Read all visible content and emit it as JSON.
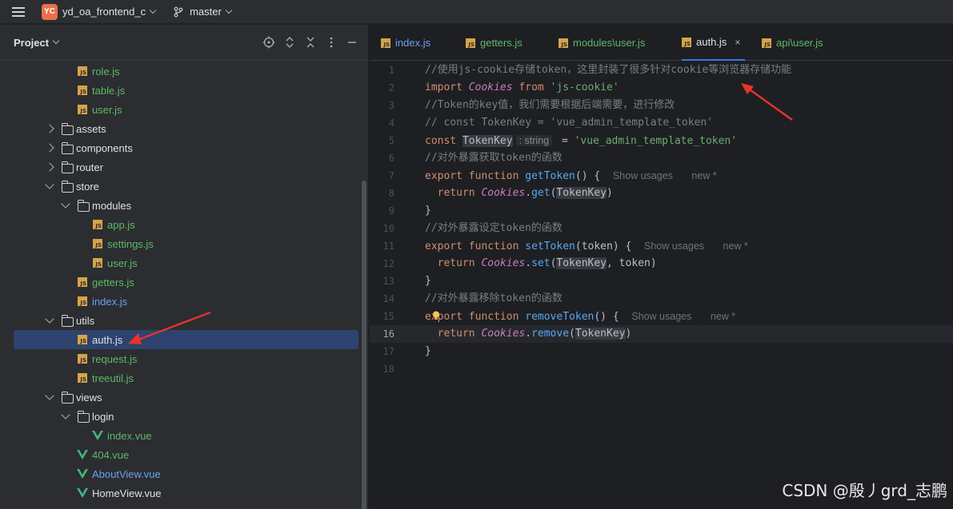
{
  "titlebar": {
    "menu_icon": "hamburger-menu-icon",
    "project_badge": "YC",
    "project_name": "yd_oa_frontend_c",
    "branch_icon": "git-branch-icon",
    "branch_name": "master"
  },
  "project_panel": {
    "title": "Project",
    "tools": [
      "locate-icon",
      "expand-collapse-icon",
      "collapse-all-icon",
      "more-icon",
      "minimize-icon"
    ],
    "tree": [
      {
        "label": "role.js",
        "type": "js",
        "depth": 2,
        "color": "green"
      },
      {
        "label": "table.js",
        "type": "js",
        "depth": 2,
        "color": "green"
      },
      {
        "label": "user.js",
        "type": "js",
        "depth": 2,
        "color": "green"
      },
      {
        "label": "assets",
        "type": "folder",
        "depth": 1,
        "state": "collapsed"
      },
      {
        "label": "components",
        "type": "folder",
        "depth": 1,
        "state": "collapsed"
      },
      {
        "label": "router",
        "type": "folder",
        "depth": 1,
        "state": "collapsed"
      },
      {
        "label": "store",
        "type": "folder",
        "depth": 1,
        "state": "expanded"
      },
      {
        "label": "modules",
        "type": "folder",
        "depth": 2,
        "state": "expanded"
      },
      {
        "label": "app.js",
        "type": "js",
        "depth": 3,
        "color": "green"
      },
      {
        "label": "settings.js",
        "type": "js",
        "depth": 3,
        "color": "green"
      },
      {
        "label": "user.js",
        "type": "js",
        "depth": 3,
        "color": "green"
      },
      {
        "label": "getters.js",
        "type": "js",
        "depth": 2,
        "color": "green"
      },
      {
        "label": "index.js",
        "type": "js",
        "depth": 2,
        "color": "blue"
      },
      {
        "label": "utils",
        "type": "folder",
        "depth": 1,
        "state": "expanded"
      },
      {
        "label": "auth.js",
        "type": "js",
        "depth": 2,
        "color": "white",
        "selected": true
      },
      {
        "label": "request.js",
        "type": "js",
        "depth": 2,
        "color": "green"
      },
      {
        "label": "treeutil.js",
        "type": "js",
        "depth": 2,
        "color": "green"
      },
      {
        "label": "views",
        "type": "folder",
        "depth": 1,
        "state": "expanded"
      },
      {
        "label": "login",
        "type": "folder",
        "depth": 2,
        "state": "expanded"
      },
      {
        "label": "index.vue",
        "type": "vue",
        "depth": 3,
        "color": "green"
      },
      {
        "label": "404.vue",
        "type": "vue",
        "depth": 2,
        "color": "green"
      },
      {
        "label": "AboutView.vue",
        "type": "vue",
        "depth": 2,
        "color": "blue"
      },
      {
        "label": "HomeView.vue",
        "type": "vue",
        "depth": 2,
        "color": "white"
      }
    ]
  },
  "editor": {
    "tabs": [
      {
        "label": "index.js",
        "color": "blue"
      },
      {
        "label": "getters.js",
        "color": "green"
      },
      {
        "label": "modules\\user.js",
        "color": "green"
      },
      {
        "label": "auth.js",
        "color": "white",
        "active": true,
        "close": "×"
      },
      {
        "label": "api\\user.js",
        "color": "green"
      }
    ],
    "hints": {
      "string_type": ": string",
      "show_usages": "Show usages",
      "new_author": "new *"
    },
    "lines": [
      {
        "n": "1",
        "text": "//使用js-cookie存储token，这里封装了很多针对cookie等浏览器存储功能"
      },
      {
        "n": "2",
        "text": "import Cookies from 'js-cookie'"
      },
      {
        "n": "3",
        "text": "//Token的key值，我们需要根据后端需要，进行修改"
      },
      {
        "n": "4",
        "text": "// const TokenKey = 'vue_admin_template_token'"
      },
      {
        "n": "5",
        "text": "const TokenKey = 'vue_admin_template_token'"
      },
      {
        "n": "6",
        "text": "//对外暴露获取token的函数"
      },
      {
        "n": "7",
        "text": "export function getToken() {"
      },
      {
        "n": "8",
        "text": "return Cookies.get(TokenKey)"
      },
      {
        "n": "9",
        "text": "}"
      },
      {
        "n": "10",
        "text": "//对外暴露设定token的函数"
      },
      {
        "n": "11",
        "text": "export function setToken(token) {"
      },
      {
        "n": "12",
        "text": "return Cookies.set(TokenKey, token)"
      },
      {
        "n": "13",
        "text": "}"
      },
      {
        "n": "14",
        "text": "//对外暴露移除token的函数"
      },
      {
        "n": "15",
        "text": "export function removeToken() {"
      },
      {
        "n": "16",
        "text": "return Cookies.remove(TokenKey)",
        "current": true
      },
      {
        "n": "17",
        "text": "}"
      },
      {
        "n": "18",
        "text": ""
      }
    ]
  },
  "watermark": "CSDN @殷丿grd_志鹏",
  "colors": {
    "accent": "#3574f0",
    "annotation_arrow": "#e8332a",
    "selection": "#2e436e"
  }
}
